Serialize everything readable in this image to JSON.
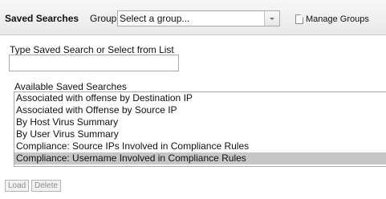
{
  "header": {
    "title": "Saved Searches",
    "group_label": "Group:",
    "group_select_value": "Select a group...",
    "manage_groups_label": "Manage Groups"
  },
  "search": {
    "label": "Type Saved Search or Select from List",
    "value": ""
  },
  "available": {
    "label": "Available Saved Searches",
    "items": [
      {
        "label": "Associated with offense by Destination IP",
        "selected": false
      },
      {
        "label": "Associated with Offense by Source IP",
        "selected": false
      },
      {
        "label": "By Host Virus Summary",
        "selected": false
      },
      {
        "label": "By User Virus Summary",
        "selected": false
      },
      {
        "label": "Compliance: Source IPs Involved in Compliance Rules",
        "selected": false
      },
      {
        "label": "Compliance: Username Involved in Compliance Rules",
        "selected": true
      }
    ]
  },
  "buttons": {
    "load_label": "Load",
    "delete_label": "Delete"
  }
}
